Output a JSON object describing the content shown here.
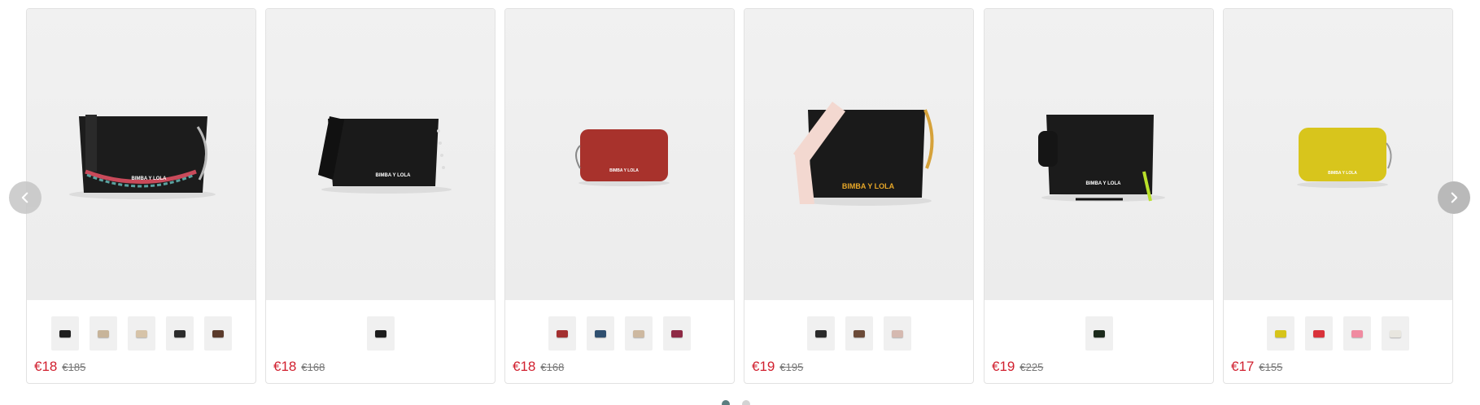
{
  "carousel": {
    "prev_icon": "chevron-left-icon",
    "next_icon": "chevron-right-icon",
    "dots": [
      {
        "active": true
      },
      {
        "active": false
      }
    ]
  },
  "products": [
    {
      "brand_print": "BIMBA Y LOLA",
      "bag_color": "#1c1c1c",
      "price": "€18",
      "old_price": "€185",
      "swatches": [
        "#1e1e1e",
        "#c7b49a",
        "#d6c3a8",
        "#2b2b2b",
        "#5a3a2a"
      ]
    },
    {
      "brand_print": "BIMBA Y LOLA",
      "bag_color": "#1a1a1a",
      "price": "€18",
      "old_price": "€168",
      "swatches": [
        "#1c1c1c"
      ]
    },
    {
      "brand_print": "BIMBA Y LOLA",
      "bag_color": "#a8322c",
      "price": "€18",
      "old_price": "€168",
      "swatches": [
        "#a33030",
        "#2f4f6f",
        "#cdb8a0",
        "#8e2a45"
      ]
    },
    {
      "brand_print": "BIMBA Y LOLA",
      "bag_color": "#1a1a1a",
      "price": "€19",
      "old_price": "€195",
      "swatches": [
        "#2a2a2a",
        "#6b4a38",
        "#d5b9b0"
      ]
    },
    {
      "brand_print": "BIMBA Y LOLA",
      "bag_color": "#1b1b1b",
      "price": "€19",
      "old_price": "€225",
      "swatches": [
        "#1b2a1b"
      ]
    },
    {
      "brand_print": "BIMBA Y LOLA",
      "bag_color": "#d8c51c",
      "price": "€17",
      "old_price": "€155",
      "swatches": [
        "#d6c41a",
        "#d9323a",
        "#f08aa0",
        "#e8e6df"
      ]
    }
  ]
}
